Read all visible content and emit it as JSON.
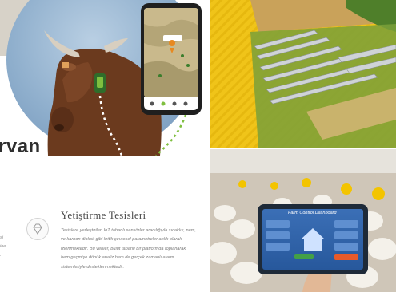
{
  "hero": {
    "brand_fragment": "rvan"
  },
  "section": {
    "title": "Yetiştirme Tesisleri",
    "body": "Tesislere yerleştirilen IoT tabanlı sensörler aracılığıyla sıcaklık, nem, ve karbon dioksit gibi kritik çevresel parametreler anlık olarak izlenmektedir. Bu veriler, bulut tabanlı bir platformda toplanarak, hem geçmişe dönük analiz hem de gerçek zamanlı alarm sistemleriyle desteklenmektedir.",
    "edge_fragment": "şi\nine\n."
  },
  "tablet": {
    "screen_title": "Farm Control Dashboard"
  },
  "colors": {
    "accent_yellow": "#f0c419",
    "map_path_green": "#7fbf3f",
    "text_dark": "#2e2e2e",
    "text_muted": "#7a7a7a"
  },
  "icons": {
    "section_icon": "gem-icon",
    "map_pin": "map-pin-icon"
  }
}
